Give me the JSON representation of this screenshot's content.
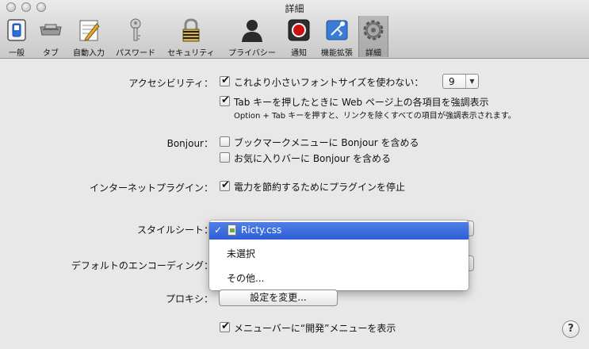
{
  "window": {
    "title": "詳細"
  },
  "toolbar": {
    "tabs": [
      {
        "label": "一般",
        "icon": "general-switch-icon"
      },
      {
        "label": "タブ",
        "icon": "tabs-icon"
      },
      {
        "label": "自動入力",
        "icon": "autofill-pencil-icon"
      },
      {
        "label": "パスワード",
        "icon": "key-icon"
      },
      {
        "label": "セキュリティ",
        "icon": "padlock-icon"
      },
      {
        "label": "プライバシー",
        "icon": "person-silhouette-icon"
      },
      {
        "label": "通知",
        "icon": "notification-icon"
      },
      {
        "label": "機能拡張",
        "icon": "extensions-icon"
      },
      {
        "label": "詳細",
        "icon": "gear-icon",
        "selected": true
      }
    ]
  },
  "accessibility": {
    "label": "アクセシビリティ：",
    "min_font_label": "これより小さいフォントサイズを使わない：",
    "min_font_checked": true,
    "min_font_value": "9",
    "tab_highlight_label": "Tab キーを押したときに Web ページ上の各項目を強調表示",
    "tab_highlight_checked": true,
    "tab_note": "Option + Tab キーを押すと、リンクを除くすべての項目が強調表示されます。"
  },
  "bonjour": {
    "label": "Bonjour：",
    "bookmarks_menu_label": "ブックマークメニューに Bonjour を含める",
    "bookmarks_menu_checked": false,
    "favorites_bar_label": "お気に入りバーに Bonjour を含める",
    "favorites_bar_checked": false
  },
  "plugins": {
    "label": "インターネットプラグイン：",
    "save_power_label": "電力を節約するためにプラグインを停止",
    "save_power_checked": true
  },
  "stylesheet": {
    "label": "スタイルシート：",
    "menu_items": [
      {
        "label": "Ricty.css",
        "checked": true
      },
      {
        "label": "未選択"
      },
      {
        "label": "その他..."
      }
    ]
  },
  "encoding": {
    "label": "デフォルトのエンコーディング："
  },
  "proxy": {
    "label": "プロキシ：",
    "button_label": "設定を変更..."
  },
  "develop_menu": {
    "label": "メニューバーに“開発”メニューを表示",
    "checked": true
  },
  "help": {
    "label": "?"
  },
  "colors": {
    "menu_highlight": "#3366dd",
    "close_button_red": "#cc1111"
  }
}
